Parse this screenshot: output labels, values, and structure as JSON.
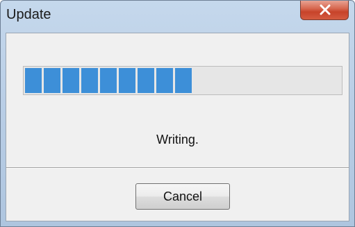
{
  "window": {
    "title": "Update",
    "close_icon": "close-icon"
  },
  "progress": {
    "fraction": 0.54,
    "block_count": 9,
    "fill_color": "#3d8fd8"
  },
  "status": {
    "text": "Writing."
  },
  "buttons": {
    "cancel_label": "Cancel"
  },
  "colors": {
    "titlebar": "#b9cee6",
    "close_button": "#c7432a",
    "client_background": "#f0f0f0"
  }
}
